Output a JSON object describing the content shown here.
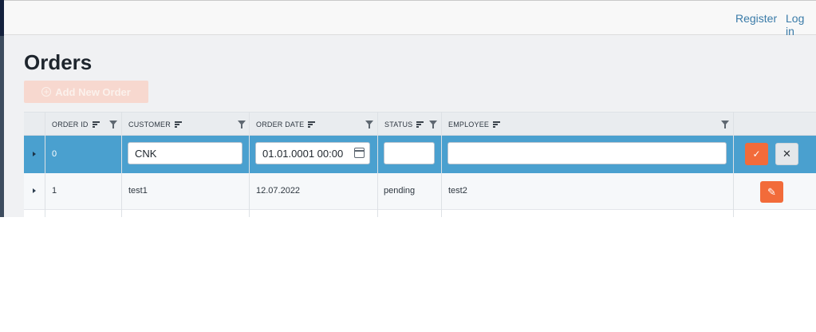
{
  "nav": {
    "register": "Register",
    "login": "Log in"
  },
  "page": {
    "title": "Orders",
    "add_button": "Add New Order"
  },
  "grid": {
    "columns": [
      "ORDER ID",
      "CUSTOMER",
      "ORDER DATE",
      "STATUS",
      "EMPLOYEE"
    ],
    "edit_row": {
      "order_id": "0",
      "customer": "CNK",
      "order_date": "01.01.0001 00:00",
      "status": "",
      "employee": ""
    },
    "rows": [
      {
        "order_id": "1",
        "customer": "test1",
        "order_date": "12.07.2022",
        "status": "pending",
        "employee": "test2"
      }
    ]
  },
  "colors": {
    "accent": "#f26b3a",
    "selected_row": "#4aa0cf",
    "link": "#3a7ba8"
  },
  "icons": {
    "add": "plus-circle-icon",
    "sort": "sort-lines-icon",
    "filter": "funnel-icon",
    "calendar": "calendar-icon",
    "save": "check-icon",
    "cancel": "close-icon",
    "edit": "pencil-icon",
    "expand": "caret-right-icon"
  }
}
